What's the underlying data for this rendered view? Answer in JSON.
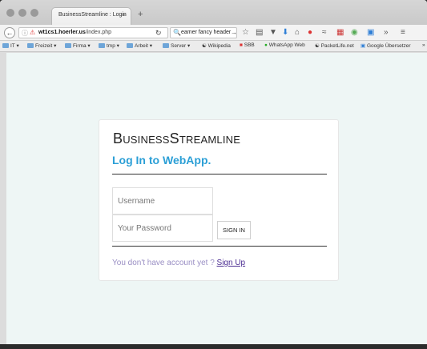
{
  "browser": {
    "tab_title": "BusinessStreamline : Login",
    "tab_menu": "≡",
    "new_tab": "+",
    "url_host": "wt1cs1.hoerler.us",
    "url_path": "/index.php",
    "search_text": "eamer fancy header",
    "bookmarks": [
      "IT",
      "Freizeit",
      "Firma",
      "tmp",
      "Arbeit",
      "Server",
      "Wikipedia",
      "SBB",
      "WhatsApp Web",
      "PacketLife.net",
      "Google Übersetzer"
    ],
    "bookmarks_more": "»"
  },
  "login": {
    "brand": "BusinessStreamline",
    "title": "Log In to WebApp.",
    "username_placeholder": "Username",
    "password_placeholder": "Your Password",
    "signin_label": "SIGN IN",
    "no_account_text": "You don't have account yet ?",
    "signup_label": "Sign Up"
  },
  "colors": {
    "accent": "#2b9fd6",
    "link": "#4a2b91",
    "muted_text": "#9a8fc4",
    "page_bg": "#eef6f5"
  }
}
